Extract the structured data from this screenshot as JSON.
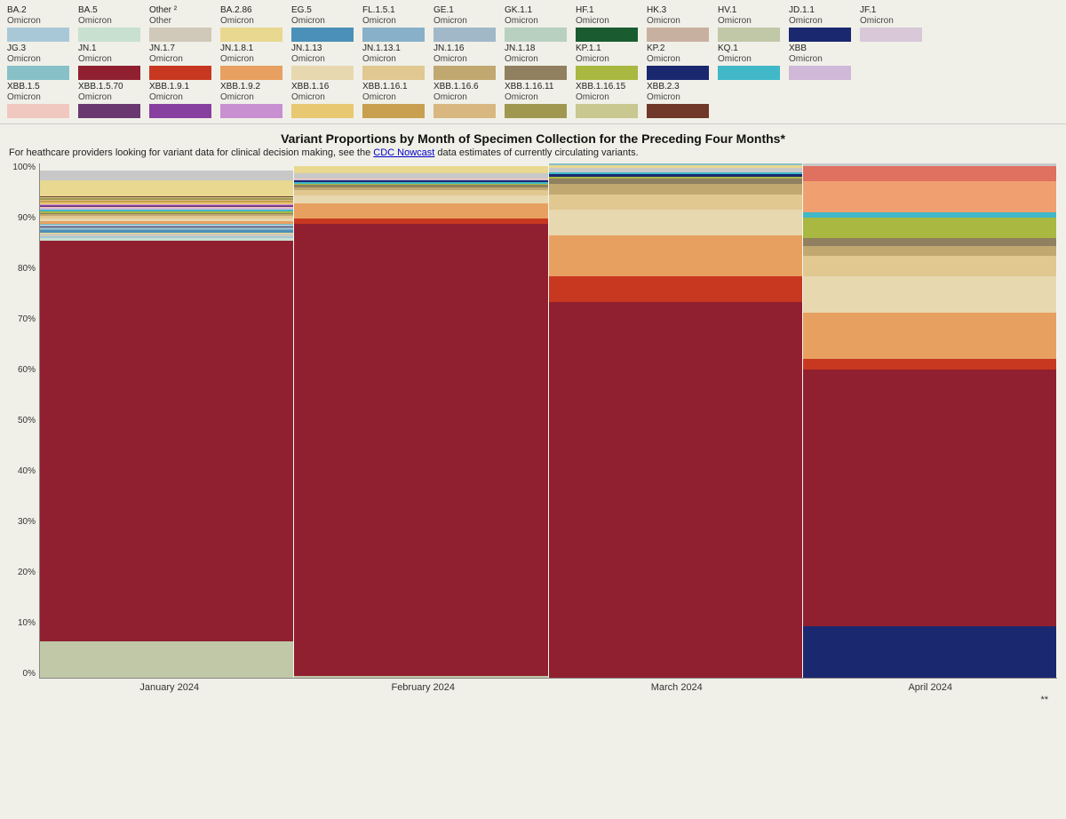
{
  "legend": {
    "rows": [
      [
        {
          "label": "BA.2",
          "sublabel": "Omicron",
          "color": "#a8c8d8"
        },
        {
          "label": "BA.5",
          "sublabel": "Omicron",
          "color": "#c8e0d0"
        },
        {
          "label": "Other ²",
          "sublabel": "Other",
          "color": "#d0c8b8"
        },
        {
          "label": "BA.2.86",
          "sublabel": "Omicron",
          "color": "#e8d890"
        },
        {
          "label": "EG.5",
          "sublabel": "Omicron",
          "color": "#4a90b8"
        },
        {
          "label": "FL.1.5.1",
          "sublabel": "Omicron",
          "color": "#88b0c8"
        },
        {
          "label": "GE.1",
          "sublabel": "Omicron",
          "color": "#a0b8c8"
        },
        {
          "label": "GK.1.1",
          "sublabel": "Omicron",
          "color": "#b8d0c0"
        },
        {
          "label": "HF.1",
          "sublabel": "Omicron",
          "color": "#1a5c30"
        },
        {
          "label": "HK.3",
          "sublabel": "Omicron",
          "color": "#c8b0a0"
        },
        {
          "label": "HV.1",
          "sublabel": "Omicron",
          "color": "#c0c8a8"
        },
        {
          "label": "JD.1.1",
          "sublabel": "Omicron",
          "color": "#1a2870"
        },
        {
          "label": "JF.1",
          "sublabel": "Omicron",
          "color": "#d8c8d8"
        }
      ],
      [
        {
          "label": "JG.3",
          "sublabel": "Omicron",
          "color": "#88c0c8"
        },
        {
          "label": "JN.1",
          "sublabel": "Omicron",
          "color": "#902030"
        },
        {
          "label": "JN.1.7",
          "sublabel": "Omicron",
          "color": "#c83820"
        },
        {
          "label": "JN.1.8.1",
          "sublabel": "Omicron",
          "color": "#e8a060"
        },
        {
          "label": "JN.1.13",
          "sublabel": "Omicron",
          "color": "#e8d8b0"
        },
        {
          "label": "JN.1.13.1",
          "sublabel": "Omicron",
          "color": "#e0c890"
        },
        {
          "label": "JN.1.16",
          "sublabel": "Omicron",
          "color": "#c0a870"
        },
        {
          "label": "JN.1.18",
          "sublabel": "Omicron",
          "color": "#908060"
        },
        {
          "label": "KP.1.1",
          "sublabel": "Omicron",
          "color": "#a8b840"
        },
        {
          "label": "KP.2",
          "sublabel": "Omicron",
          "color": "#1a2870"
        },
        {
          "label": "KQ.1",
          "sublabel": "Omicron",
          "color": "#40b8c8"
        },
        {
          "label": "XBB",
          "sublabel": "Omicron",
          "color": "#d0b8d8"
        }
      ],
      [
        {
          "label": "XBB.1.5",
          "sublabel": "Omicron",
          "color": "#f0c8c0"
        },
        {
          "label": "XBB.1.5.70",
          "sublabel": "Omicron",
          "color": "#6a3870"
        },
        {
          "label": "XBB.1.9.1",
          "sublabel": "Omicron",
          "color": "#8840a0"
        },
        {
          "label": "XBB.1.9.2",
          "sublabel": "Omicron",
          "color": "#c890d0"
        },
        {
          "label": "XBB.1.16",
          "sublabel": "Omicron",
          "color": "#e8c870"
        },
        {
          "label": "XBB.1.16.1",
          "sublabel": "Omicron",
          "color": "#c8a050"
        },
        {
          "label": "XBB.1.16.6",
          "sublabel": "Omicron",
          "color": "#d8b880"
        },
        {
          "label": "XBB.1.16.11",
          "sublabel": "Omicron",
          "color": "#a09850"
        },
        {
          "label": "XBB.1.16.15",
          "sublabel": "Omicron",
          "color": "#c8c890"
        },
        {
          "label": "XBB.2.3",
          "sublabel": "Omicron",
          "color": "#703828"
        }
      ]
    ]
  },
  "chart": {
    "title": "Variant Proportions by Month of Specimen Collection for the Preceding Four Months*",
    "subtitle": "For heathcare providers looking for variant data for clinical decision making, see the",
    "link_text": "CDC Nowcast",
    "subtitle2": "data estimates of currently circulating variants.",
    "y_labels": [
      "100%",
      "90%",
      "80%",
      "70%",
      "60%",
      "50%",
      "40%",
      "30%",
      "20%",
      "10%",
      "0%"
    ],
    "x_labels": [
      "January 2024",
      "February 2024",
      "March 2024",
      "April 2024"
    ],
    "star_note": "**",
    "months": [
      {
        "name": "January 2024",
        "segments": [
          {
            "color": "#c0c8a8",
            "pct": 7
          },
          {
            "color": "#902030",
            "pct": 78
          },
          {
            "color": "#c8e0d0",
            "pct": 0.5
          },
          {
            "color": "#a8c8d8",
            "pct": 0.3
          },
          {
            "color": "#d0c8b8",
            "pct": 0.5
          },
          {
            "color": "#e8d890",
            "pct": 0.3
          },
          {
            "color": "#4a90b8",
            "pct": 0.5
          },
          {
            "color": "#88b0c8",
            "pct": 0.3
          },
          {
            "color": "#b8d0c0",
            "pct": 0.2
          },
          {
            "color": "#1a2870",
            "pct": 0.2
          },
          {
            "color": "#d8c8d8",
            "pct": 0.2
          },
          {
            "color": "#88c0c8",
            "pct": 0.3
          },
          {
            "color": "#e8a060",
            "pct": 0.5
          },
          {
            "color": "#e8d8b0",
            "pct": 0.5
          },
          {
            "color": "#e0c890",
            "pct": 0.5
          },
          {
            "color": "#c0a870",
            "pct": 0.3
          },
          {
            "color": "#908060",
            "pct": 0.3
          },
          {
            "color": "#a8b840",
            "pct": 0.3
          },
          {
            "color": "#40b8c8",
            "pct": 0.3
          },
          {
            "color": "#d0b8d8",
            "pct": 0.3
          },
          {
            "color": "#f0c8c0",
            "pct": 0.2
          },
          {
            "color": "#6a3870",
            "pct": 0.2
          },
          {
            "color": "#8840a0",
            "pct": 0.2
          },
          {
            "color": "#c890d0",
            "pct": 0.2
          },
          {
            "color": "#e8c870",
            "pct": 0.3
          },
          {
            "color": "#c8a050",
            "pct": 0.3
          },
          {
            "color": "#d8b880",
            "pct": 0.3
          },
          {
            "color": "#a09850",
            "pct": 0.3
          },
          {
            "color": "#c8c890",
            "pct": 0.2
          },
          {
            "color": "#703828",
            "pct": 0.2
          },
          {
            "color": "#e8d890",
            "pct": 3
          },
          {
            "color": "#c8c8c8",
            "pct": 2
          }
        ]
      },
      {
        "name": "February 2024",
        "segments": [
          {
            "color": "#c0c8a8",
            "pct": 0.3
          },
          {
            "color": "#902030",
            "pct": 88
          },
          {
            "color": "#c83820",
            "pct": 1
          },
          {
            "color": "#e8a060",
            "pct": 3
          },
          {
            "color": "#e8d8b0",
            "pct": 1.5
          },
          {
            "color": "#e0c890",
            "pct": 1
          },
          {
            "color": "#c0a870",
            "pct": 0.5
          },
          {
            "color": "#908060",
            "pct": 0.5
          },
          {
            "color": "#a8b840",
            "pct": 0.3
          },
          {
            "color": "#40b8c8",
            "pct": 0.3
          },
          {
            "color": "#1a2870",
            "pct": 0.3
          },
          {
            "color": "#d0b8d8",
            "pct": 0.2
          },
          {
            "color": "#f0c8c0",
            "pct": 0.2
          },
          {
            "color": "#c8c8c8",
            "pct": 1
          },
          {
            "color": "#e8d890",
            "pct": 1.4
          }
        ]
      },
      {
        "name": "March 2024",
        "segments": [
          {
            "color": "#902030",
            "pct": 73
          },
          {
            "color": "#c83820",
            "pct": 5
          },
          {
            "color": "#e8a060",
            "pct": 8
          },
          {
            "color": "#e8d8b0",
            "pct": 5
          },
          {
            "color": "#e0c890",
            "pct": 3
          },
          {
            "color": "#c0a870",
            "pct": 2
          },
          {
            "color": "#908060",
            "pct": 1
          },
          {
            "color": "#a8b840",
            "pct": 0.5
          },
          {
            "color": "#1a2870",
            "pct": 0.5
          },
          {
            "color": "#40b8c8",
            "pct": 0.3
          },
          {
            "color": "#c8c8c8",
            "pct": 0.8
          },
          {
            "color": "#e8d890",
            "pct": 0.5
          },
          {
            "color": "#88c0c8",
            "pct": 0.4
          }
        ]
      },
      {
        "name": "April 2024",
        "segments": [
          {
            "color": "#1a2870",
            "pct": 10
          },
          {
            "color": "#902030",
            "pct": 50
          },
          {
            "color": "#c83820",
            "pct": 2
          },
          {
            "color": "#e8a060",
            "pct": 9
          },
          {
            "color": "#e8d8b0",
            "pct": 7
          },
          {
            "color": "#e0c890",
            "pct": 4
          },
          {
            "color": "#c0a870",
            "pct": 2
          },
          {
            "color": "#908060",
            "pct": 1.5
          },
          {
            "color": "#a8b840",
            "pct": 4
          },
          {
            "color": "#40b8c8",
            "pct": 1
          },
          {
            "color": "#f0a070",
            "pct": 6
          },
          {
            "color": "#e07060",
            "pct": 3
          },
          {
            "color": "#c8c8c8",
            "pct": 0.5
          }
        ]
      }
    ]
  }
}
